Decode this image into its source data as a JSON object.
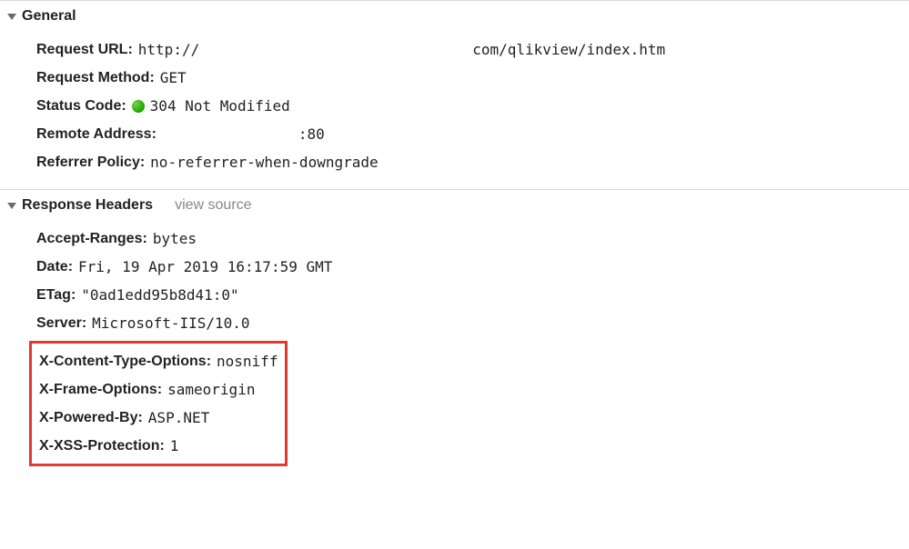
{
  "general": {
    "title": "General",
    "request_url_label": "Request URL",
    "request_url_prefix": "http://",
    "request_url_suffix": "com/qlikview/index.htm",
    "request_method_label": "Request Method",
    "request_method_value": "GET",
    "status_code_label": "Status Code",
    "status_code_value": "304 Not Modified",
    "remote_address_label": "Remote Address",
    "remote_address_value": ":80",
    "referrer_policy_label": "Referrer Policy",
    "referrer_policy_value": "no-referrer-when-downgrade"
  },
  "response": {
    "title": "Response Headers",
    "view_source": "view source",
    "accept_ranges_label": "Accept-Ranges",
    "accept_ranges_value": "bytes",
    "date_label": "Date",
    "date_value": "Fri, 19 Apr 2019 16:17:59 GMT",
    "etag_label": "ETag",
    "etag_value": "\"0ad1edd95b8d41:0\"",
    "server_label": "Server",
    "server_value": "Microsoft-IIS/10.0",
    "x_content_type_label": "X-Content-Type-Options",
    "x_content_type_value": "nosniff",
    "x_frame_options_label": "X-Frame-Options",
    "x_frame_options_value": "sameorigin",
    "x_powered_by_label": "X-Powered-By",
    "x_powered_by_value": "ASP.NET",
    "x_xss_protection_label": "X-XSS-Protection",
    "x_xss_protection_value": "1"
  }
}
